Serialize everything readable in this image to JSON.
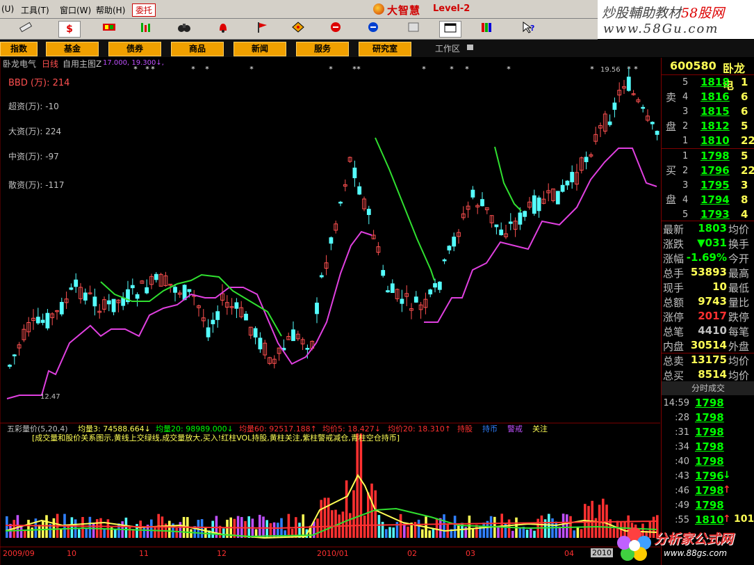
{
  "menubar": {
    "items": [
      "(U)",
      "工具(T)",
      "窗口(W)",
      "帮助(H)"
    ],
    "entrust": "委托"
  },
  "app": {
    "brand": "大智慧",
    "version": "Level-2"
  },
  "watermark_top": {
    "line1_a": "炒股輔助教材",
    "line1_b": "58股网",
    "line2": "www.58Gu.com"
  },
  "toolbar": {
    "icons": [
      "ruler-icon",
      "dollar-icon",
      "stock-grid-icon",
      "bar-chart-icon",
      "binoculars-icon",
      "bell-icon",
      "flag-icon",
      "diamond-icon",
      "red-circle-icon",
      "blue-circle-icon",
      "doc-icon",
      "window-icon",
      "books-icon",
      "help-icon"
    ]
  },
  "nav": {
    "buttons": [
      "指数",
      "基金",
      "债券",
      "商品",
      "新闻",
      "服务",
      "研究室"
    ],
    "workspace": "工作区"
  },
  "main": {
    "header_name": "卧龙电气",
    "header_period": "日线",
    "header_type": "自用主图Z",
    "header_vals": "17.000, 19.300↓,",
    "bbd": "BBD (万): 214",
    "super": "超资(万): -10",
    "big": "大资(万): 224",
    "mid": "中资(万): -97",
    "retail": "散资(万): -117",
    "high_label": "19.56",
    "low_label": "12.47"
  },
  "sub": {
    "name": "五彩量价(5,20,4)",
    "avg3": "均量3: 74588.664↓",
    "avg20": "均量20: 98989.000↓",
    "avg60": "均量60: 92517.188↑",
    "price5": "均价5: 18.427↓",
    "price20": "均价20: 18.310↑",
    "hold": "持股",
    "hold_cash": "持币",
    "alert": "警戒",
    "watch": "关注",
    "desc": "[成交量和股价关系图示,黄线上交绿线,成交量放大,买入!红柱VOL持股,黄柱关注,紫柱警戒减仓,青柱空仓持币]"
  },
  "xaxis": [
    "2009/09",
    "10",
    "11",
    "12",
    "2010/01",
    "02",
    "03",
    "04",
    "2010"
  ],
  "quote": {
    "code": "600580",
    "name": "卧龙电",
    "sell_label": [
      "卖",
      "盘"
    ],
    "buy_label": [
      "买",
      "盘"
    ],
    "asks": [
      {
        "level": "5",
        "price": "1818",
        "vol": "1"
      },
      {
        "level": "4",
        "price": "1816",
        "vol": "6"
      },
      {
        "level": "3",
        "price": "1815",
        "vol": "6"
      },
      {
        "level": "2",
        "price": "1812",
        "vol": "5"
      },
      {
        "level": "1",
        "price": "1810",
        "vol": "22"
      }
    ],
    "bids": [
      {
        "level": "1",
        "price": "1798",
        "vol": "5"
      },
      {
        "level": "2",
        "price": "1796",
        "vol": "22"
      },
      {
        "level": "3",
        "price": "1795",
        "vol": "3"
      },
      {
        "level": "4",
        "price": "1794",
        "vol": "8"
      },
      {
        "level": "5",
        "price": "1793",
        "vol": "4"
      }
    ],
    "stats": [
      {
        "label": "最新",
        "value": "1803",
        "color": "#00ff00",
        "label2": "均价"
      },
      {
        "label": "涨跌",
        "value": "▼031",
        "color": "#00ff00",
        "label2": "换手"
      },
      {
        "label": "涨幅",
        "value": "-1.69%",
        "color": "#00ff00",
        "label2": "今开"
      },
      {
        "label": "总手",
        "value": "53893",
        "color": "#ffff55",
        "label2": "最高"
      },
      {
        "label": "现手",
        "value": "10",
        "color": "#ffff55",
        "label2": "最低"
      },
      {
        "label": "总额",
        "value": "9743",
        "color": "#ffff55",
        "label2": "量比"
      },
      {
        "label": "涨停",
        "value": "2017",
        "color": "#ff3030",
        "label2": "跌停"
      },
      {
        "label": "总笔",
        "value": "4410",
        "color": "#c0c0c0",
        "label2": "每笔"
      },
      {
        "label": "内盘",
        "value": "30514",
        "color": "#ffff55",
        "label2": "外盘"
      },
      {
        "label": "总卖",
        "value": "13175",
        "color": "#ffff55",
        "label2": "均价"
      },
      {
        "label": "总买",
        "value": "8514",
        "color": "#ffff55",
        "label2": "均价"
      }
    ],
    "ticks_title": "分时成交",
    "ticks": [
      {
        "time": "14:59",
        "price": "1798",
        "arrow": "",
        "vol": ""
      },
      {
        "time": ":28",
        "price": "1798",
        "arrow": "",
        "vol": ""
      },
      {
        "time": ":31",
        "price": "1798",
        "arrow": "",
        "vol": ""
      },
      {
        "time": ":34",
        "price": "1798",
        "arrow": "",
        "vol": ""
      },
      {
        "time": ":40",
        "price": "1798",
        "arrow": "",
        "vol": ""
      },
      {
        "time": ":43",
        "price": "1796",
        "arrow": "↓",
        "vol": ""
      },
      {
        "time": ":46",
        "price": "1798",
        "arrow": "↑",
        "vol": ""
      },
      {
        "time": ":49",
        "price": "1798",
        "arrow": "",
        "vol": ""
      },
      {
        "time": ":55",
        "price": "1810",
        "arrow": "↑",
        "vol": "101"
      }
    ]
  },
  "watermark_bottom": {
    "t1": "分析家公式网",
    "t2": "www.88gs.com"
  }
}
